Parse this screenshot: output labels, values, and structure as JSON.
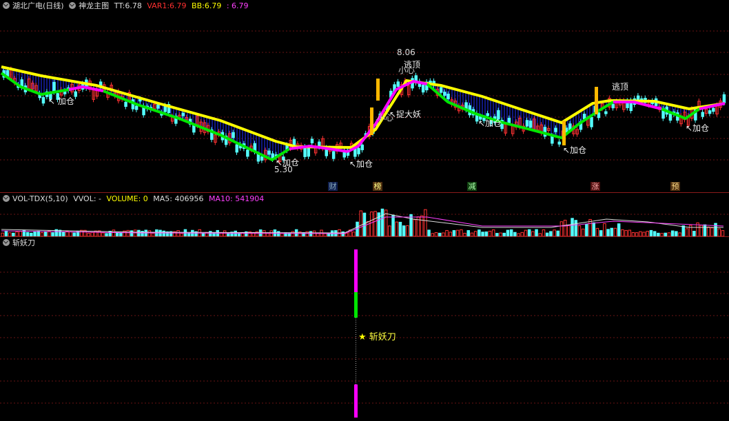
{
  "main": {
    "stock": "湖北广电(日线)",
    "indicator": "神龙主图",
    "tt_label": "TT:",
    "tt_value": "6.78",
    "var1_label": "VAR1:",
    "var1_value": "6.79",
    "bb_label": "BB:",
    "bb_value": "6.79",
    "extra_value": ": 6.79",
    "high_price": "8.06",
    "low_price": "5.30",
    "annotations": {
      "add1": "加仓",
      "add2": "加仓",
      "add3": "加仓",
      "add4": "加仓",
      "add5": "加仓",
      "add6": "加仓",
      "add7": "加仓",
      "escape1": "逃顶",
      "escape2": "逃顶",
      "catch": "捉大妖",
      "careful": "小心",
      "careful2": "小心"
    },
    "events": [
      "财",
      "榜",
      "减",
      "涨",
      "预"
    ]
  },
  "volume": {
    "name": "VOL-TDX(5,10)",
    "vvol": "VVOL: -",
    "volume": "VOLUME: 0",
    "ma5": "MA5: 406956",
    "ma10": "MA10: 541904"
  },
  "bottom": {
    "name": "斩妖刀",
    "signal": "斩妖刀"
  },
  "colors": {
    "up": "#ff3232",
    "down": "#54ffff",
    "yellow": "#ffff00",
    "green": "#00e600",
    "magenta": "#ff00ff",
    "blue": "#2030ff"
  }
}
